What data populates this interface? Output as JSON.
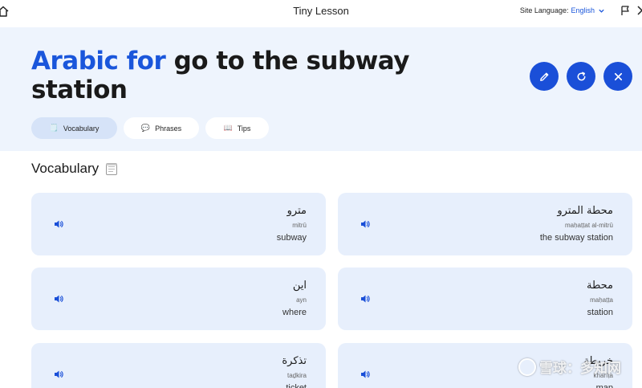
{
  "app": {
    "title": "Tiny Lesson"
  },
  "header": {
    "site_language_label": "Site Language:",
    "site_language_value": "English"
  },
  "hero": {
    "title_accent": "Arabic for",
    "title_rest": "go to the subway station"
  },
  "tabs": [
    {
      "emoji": "🗒️",
      "label": "Vocabulary",
      "active": true
    },
    {
      "emoji": "💬",
      "label": "Phrases",
      "active": false
    },
    {
      "emoji": "📖",
      "label": "Tips",
      "active": false
    }
  ],
  "section": {
    "title": "Vocabulary"
  },
  "vocab": [
    {
      "arabic": "مترو",
      "translit": "mitrū",
      "english": "subway"
    },
    {
      "arabic": "محطة المترو",
      "translit": "maḥaṭṭat al-mitrū",
      "english": "the subway station"
    },
    {
      "arabic": "اين",
      "translit": "ayn",
      "english": "where"
    },
    {
      "arabic": "محطة",
      "translit": "maḥaṭṭa",
      "english": "station"
    },
    {
      "arabic": "تذكرة",
      "translit": "taḏkira",
      "english": "ticket"
    },
    {
      "arabic": "خريطة",
      "translit": "kharīṭa",
      "english": "map"
    }
  ],
  "watermark": {
    "text": "雪球：多知网"
  },
  "colors": {
    "accent": "#1a56db",
    "hero_bg": "#eef4fd",
    "card_bg": "#e7effc",
    "button_bg": "#1a4fd8"
  },
  "icons": [
    "home-icon",
    "chevron-down-icon",
    "flag-icon",
    "chevron-right-icon",
    "pencil-icon",
    "refresh-icon",
    "close-icon",
    "speaker-icon",
    "notepad-icon"
  ]
}
